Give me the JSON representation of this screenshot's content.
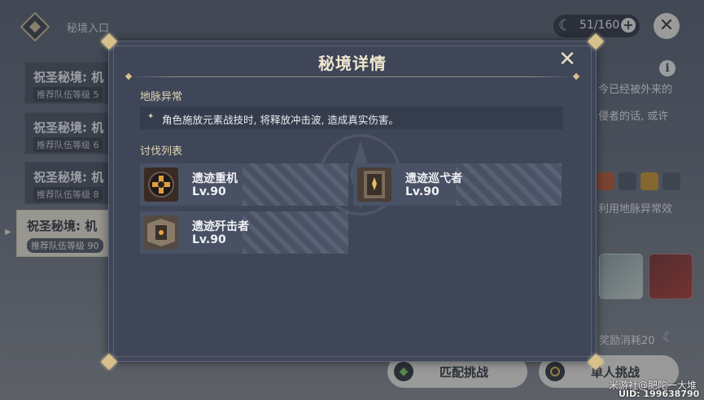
{
  "topbar": {
    "domain_entry_label": "秘境入口",
    "resin_count": "51/160",
    "resin_plus": "+",
    "close_glyph": "✕"
  },
  "domain_list": [
    {
      "title": "祝圣秘境: 机",
      "level": "推荐队伍等级 5"
    },
    {
      "title": "祝圣秘境: 机",
      "level": "推荐队伍等级 6"
    },
    {
      "title": "祝圣秘境: 机",
      "level": "推荐队伍等级 8"
    },
    {
      "title": "祝圣秘境: 机",
      "level": "推荐队伍等级 90"
    }
  ],
  "background_right": {
    "info_glyph": "i",
    "desc_line1": "今已经被外来的",
    "desc_line2": "侵者的话, 或许",
    "ley_hint": "利用地脉异常效",
    "reward_cost": "奖励消耗20"
  },
  "buttons": {
    "match_label": "匹配挑战",
    "solo_label": "单人挑战"
  },
  "watermark": {
    "line1": "米游社@肥陀一大堆",
    "line2": "UID: 199638790"
  },
  "modal": {
    "title": "秘境详情",
    "close_glyph": "✕",
    "ley_section_title": "地脉异常",
    "ley_effect": "角色施放元素战技时, 将释放冲击波, 造成真实伤害。",
    "enemies_section_title": "讨伐列表",
    "enemies": [
      {
        "name": "遗迹重机",
        "level": "Lv.90",
        "icon": "ruin-grader-icon"
      },
      {
        "name": "遗迹巡弋者",
        "level": "Lv.90",
        "icon": "ruin-cruiser-icon"
      },
      {
        "name": "遗迹歼击者",
        "level": "Lv.90",
        "icon": "ruin-destroyer-icon"
      }
    ]
  },
  "colors": {
    "modal_bg": "#3e4658",
    "gold_accent": "#d8c08a",
    "section_title": "#e3d6b2"
  }
}
